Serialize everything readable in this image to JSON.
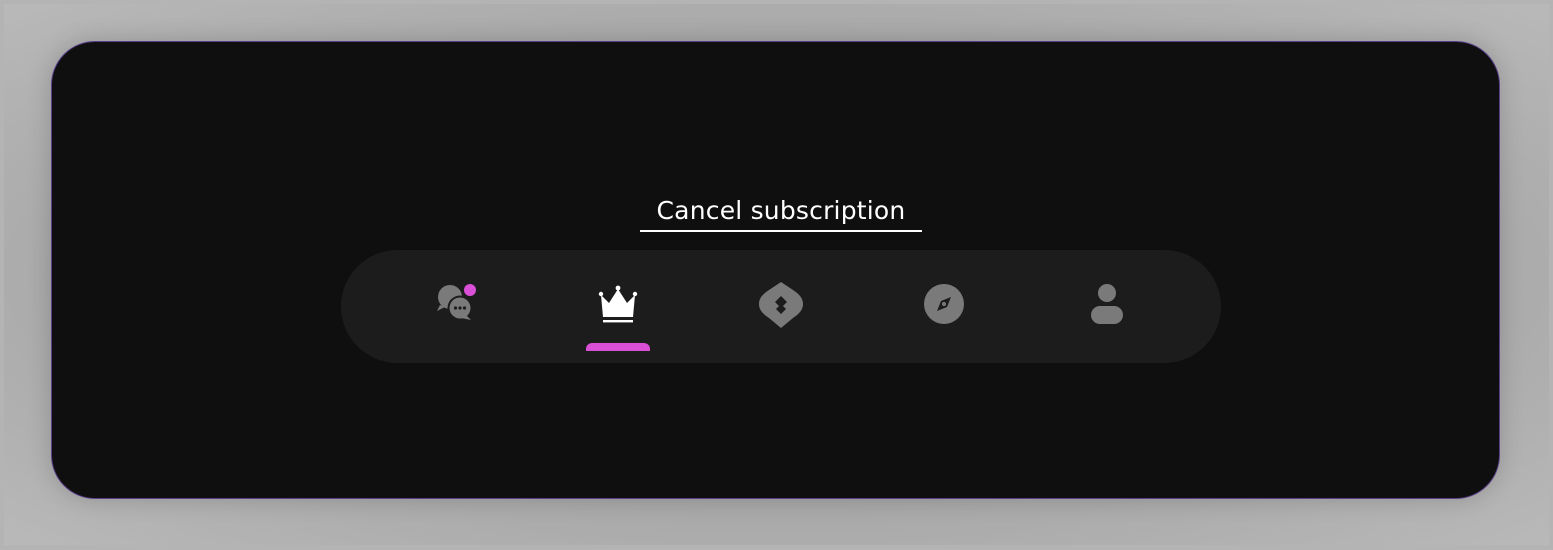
{
  "cancel": {
    "label": "Cancel subscription"
  },
  "nav": {
    "items": [
      {
        "name": "chat",
        "icon": "chat-bubbles-icon",
        "active": false,
        "has_notification": true
      },
      {
        "name": "premium",
        "icon": "crown-icon",
        "active": true,
        "has_notification": false
      },
      {
        "name": "likes",
        "icon": "heart-shape-icon",
        "active": false,
        "has_notification": false
      },
      {
        "name": "discover",
        "icon": "compass-icon",
        "active": false,
        "has_notification": false
      },
      {
        "name": "profile",
        "icon": "user-icon",
        "active": false,
        "has_notification": false
      }
    ],
    "accent_color": "#d94fd5",
    "inactive_color": "#7a7a7a",
    "active_color": "#ffffff"
  }
}
